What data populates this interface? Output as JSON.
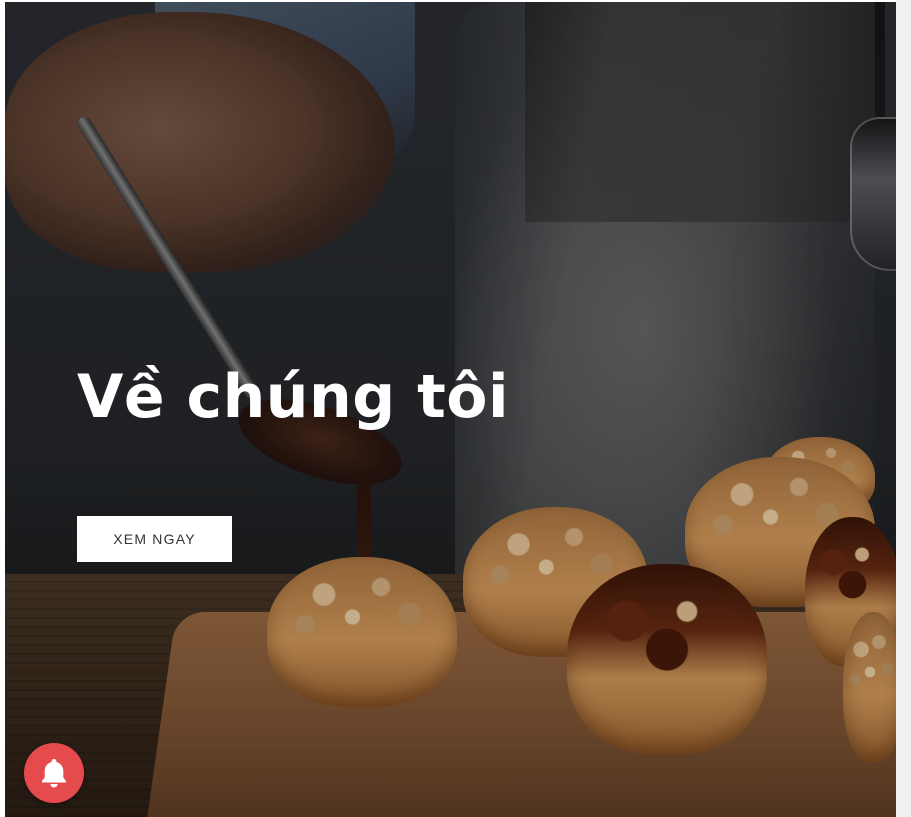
{
  "hero": {
    "title": "Về chúng tôi",
    "button_label": "XEM NGAY"
  },
  "notification": {
    "icon": "bell-icon",
    "color": "#e54b4d"
  },
  "colors": {
    "title_text": "#ffffff",
    "button_bg": "#ffffff",
    "button_text": "#333333"
  }
}
